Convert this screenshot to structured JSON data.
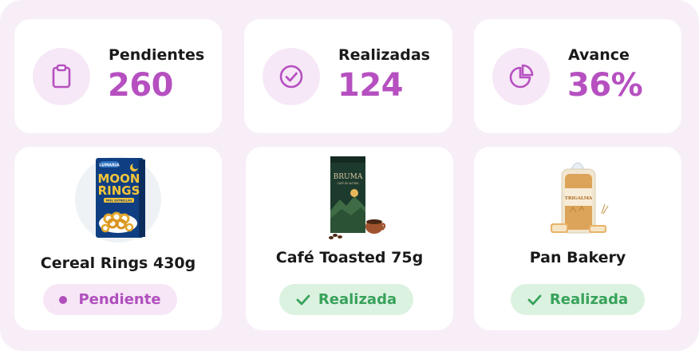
{
  "stats": [
    {
      "label": "Pendientes",
      "value": "260",
      "icon": "clipboard-icon"
    },
    {
      "label": "Realizadas",
      "value": "124",
      "icon": "check-circle-icon"
    },
    {
      "label": "Avance",
      "value": "36%",
      "icon": "pie-chart-icon"
    }
  ],
  "products": [
    {
      "name": "Cereal Rings 430g",
      "status": "Pendiente",
      "status_kind": "pending",
      "image": "cereal-box-image",
      "package_text": {
        "brand": "LUMARIA",
        "line1": "MOON",
        "line2": "RINGS",
        "tag": "MIEL ESTRELLAS"
      }
    },
    {
      "name": "Café Toasted 75g",
      "status": "Realizada",
      "status_kind": "done",
      "image": "coffee-bag-image",
      "package_text": {
        "brand": "BRUMA",
        "tag": "CAFÉ DE ALTURA"
      }
    },
    {
      "name": "Pan Bakery",
      "status": "Realizada",
      "status_kind": "done",
      "image": "bread-loaf-image",
      "package_text": {
        "brand": "TRIGALMA"
      }
    }
  ],
  "colors": {
    "accent": "#b650c0",
    "icon_bg": "#f6e8f7",
    "pending_bg": "#f6e6f6",
    "done_bg": "#dcf2e1",
    "done_text": "#37a25a",
    "frame_bg": "#f7eef8"
  }
}
